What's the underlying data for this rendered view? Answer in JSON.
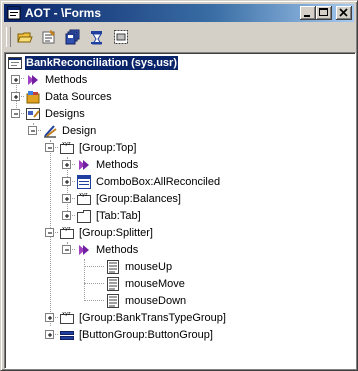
{
  "window": {
    "title": "AOT - \\Forms",
    "title_icon": "aot-window-icon",
    "buttons": [
      "minimize-button",
      "maximize-button",
      "close-button"
    ]
  },
  "toolbar": {
    "buttons": [
      {
        "name": "open-icon"
      },
      {
        "name": "properties-icon"
      },
      {
        "name": "save-all-icon"
      },
      {
        "name": "compile-icon"
      },
      {
        "name": "layout-icon"
      }
    ]
  },
  "tree": {
    "root": "BankReconciliation (sys,usr)",
    "methods": "Methods",
    "data_sources": "Data Sources",
    "designs": "Designs",
    "design": "Design",
    "group_top": "[Group:Top]",
    "group_top_methods": "Methods",
    "combobox": "ComboBox:AllReconciled",
    "group_balances": "[Group:Balances]",
    "tab": "[Tab:Tab]",
    "group_splitter": "[Group:Splitter]",
    "splitter_methods": "Methods",
    "mouse_up": "mouseUp",
    "mouse_move": "mouseMove",
    "mouse_down": "mouseDown",
    "group_bank_trans": "[Group:BankTransTypeGroup]",
    "button_group": "[ButtonGroup:ButtonGroup]"
  }
}
